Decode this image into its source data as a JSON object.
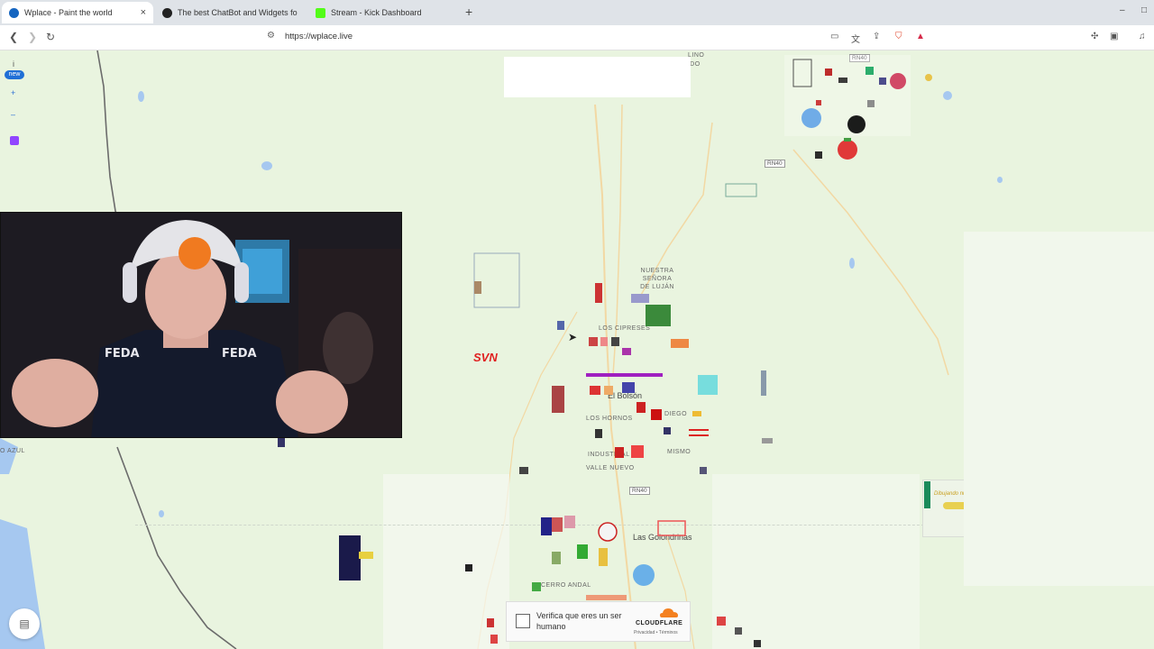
{
  "browser": {
    "tabs": [
      {
        "title": "Wplace - Paint the world",
        "color": "#1565c0",
        "active": true
      },
      {
        "title": "The best ChatBot and Widgets for Ki",
        "color": "#222222",
        "active": false
      },
      {
        "title": "Stream - Kick Dashboard",
        "color": "#53fc18",
        "active": false
      }
    ],
    "new_tab": "+",
    "close_glyph": "×",
    "url": "https://wplace.live",
    "window_controls": {
      "minimize": "–",
      "maximize": "□"
    }
  },
  "map": {
    "labels": {
      "luján": "NUESTRA SEÑORA\nDE LUJÁN",
      "cerro_andal": "CERRO ANDAL",
      "azul": "O AZUL",
      "valle_nuevo": "VALLE NUEVO",
      "los_cipreses": "LOS CIPRESES",
      "industrial": "INDUSTRIAL",
      "los_hornos": "LOS HORNOS",
      "cerro_azul": "ADO",
      "mismo": "MISMO",
      "diego": "DIEGO",
      "town_elbolson": "El Bolsón",
      "town_golondrinas": "Las Golondrinas",
      "road_a": "RN40",
      "road_b": "RN40",
      "road_c": "RN40",
      "top_lino": "LINO",
      "graffiti_red": "SVN",
      "sign_text": "Dibujando nuevo"
    },
    "colors": {
      "water": "#a6c8f0",
      "land": "#e9f4df",
      "road": "#f3d9a8"
    }
  },
  "left_toolbar": {
    "info": "i",
    "new_badge": "new",
    "zoom_in": "+",
    "zoom_out": "–",
    "twitch_icon": "twitch-icon"
  },
  "captcha": {
    "prompt": "Verifica que eres un ser humano",
    "brand": "CLOUDFLARE",
    "links": "Privacidad • Términos"
  }
}
